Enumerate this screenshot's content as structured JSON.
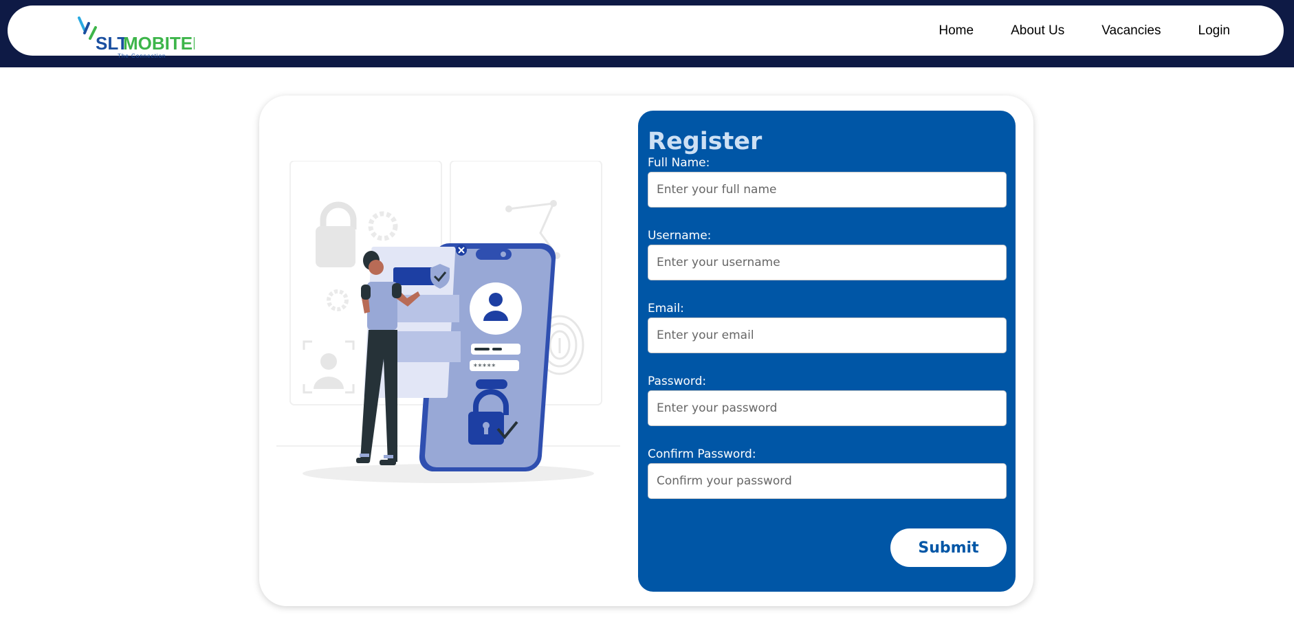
{
  "brand": {
    "name_part1": "SLT",
    "name_part2": "MOBITEL",
    "tagline": "The Connection",
    "color_blue": "#1a4fa0",
    "color_green": "#3db54a"
  },
  "nav": {
    "items": [
      {
        "label": "Home"
      },
      {
        "label": "About Us"
      },
      {
        "label": "Vacancies"
      },
      {
        "label": "Login"
      }
    ]
  },
  "form": {
    "title": "Register",
    "fields": [
      {
        "label": "Full Name:",
        "placeholder": "Enter your full name",
        "value": ""
      },
      {
        "label": "Username:",
        "placeholder": "Enter your username",
        "value": ""
      },
      {
        "label": "Email:",
        "placeholder": "Enter your email",
        "value": ""
      },
      {
        "label": "Password:",
        "placeholder": "Enter your password",
        "value": ""
      },
      {
        "label": "Confirm Password:",
        "placeholder": "Confirm your password",
        "value": ""
      }
    ],
    "submit_label": "Submit"
  },
  "illustration": {
    "password_mask": "*****"
  },
  "colors": {
    "header_band": "#0e1a45",
    "panel": "#0056a6",
    "title": "#cde0f4",
    "illustration_accent": "#1d3fa3",
    "illustration_light": "#98a8d6"
  }
}
